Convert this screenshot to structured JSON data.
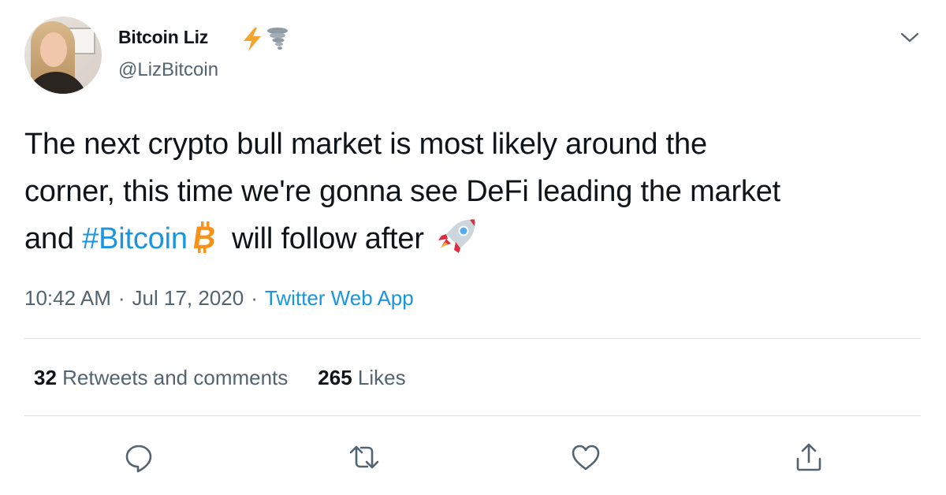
{
  "author": {
    "display_name": "Bitcoin Liz",
    "name_emojis": [
      "lightning-icon",
      "tornado-icon"
    ],
    "handle": "@LizBitcoin"
  },
  "tweet": {
    "line1": "The next crypto bull market is most likely around the",
    "line2": "corner, this time we're gonna see DeFi leading the market",
    "line3_prefix": "and ",
    "hashtag": "#Bitcoin",
    "line3_suffix": " will follow after",
    "emojis": [
      "bitcoin-icon",
      "rocket-icon"
    ]
  },
  "meta": {
    "time": "10:42 AM",
    "date": "Jul 17, 2020",
    "separator": "·",
    "source": "Twitter Web App"
  },
  "stats": {
    "retweets_count": "32",
    "retweets_label": "Retweets and comments",
    "likes_count": "265",
    "likes_label": "Likes"
  },
  "actions": [
    "reply-icon",
    "retweet-icon",
    "like-icon",
    "share-icon"
  ],
  "colors": {
    "link": "#1b95e0",
    "secondary_text": "#536471",
    "bitcoin": "#f7931a"
  }
}
